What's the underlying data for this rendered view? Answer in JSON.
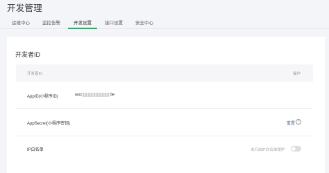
{
  "page": {
    "title": "开发管理"
  },
  "tabs": [
    {
      "label": "运维中心"
    },
    {
      "label": "监控告警"
    },
    {
      "label": "开发设置"
    },
    {
      "label": "接口设置"
    },
    {
      "label": "安全中心"
    }
  ],
  "active_tab": "开发设置",
  "section": {
    "title": "开发者ID",
    "table": {
      "col_left": "开发者ID",
      "col_right": "操作"
    },
    "rows": {
      "appid": {
        "label": "AppID(小程序ID)",
        "value_prefix": "wxc",
        "value_suffix": "0e"
      },
      "secret": {
        "label": "AppSecret(小程序密钥)",
        "action": "重置",
        "help": "?"
      },
      "ip": {
        "label": "IP白名单",
        "toggle_label": "未开启IP白名单保护",
        "enabled": false
      }
    }
  },
  "colors": {
    "accent": "#07c160",
    "link": "#576b95"
  }
}
